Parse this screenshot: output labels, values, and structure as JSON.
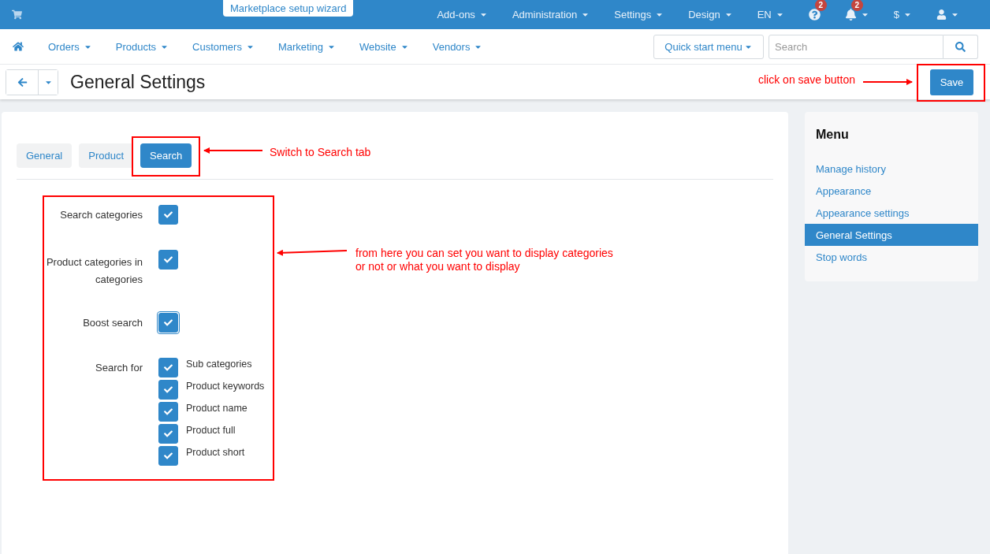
{
  "top_bar": {
    "wizard_button": "Marketplace setup wizard",
    "items": [
      {
        "kind": "menu",
        "label": "Add-ons"
      },
      {
        "kind": "menu",
        "label": "Administration"
      },
      {
        "kind": "menu",
        "label": "Settings"
      },
      {
        "kind": "menu",
        "label": "Design"
      },
      {
        "kind": "menu",
        "label": "EN"
      },
      {
        "kind": "help",
        "badge": "2"
      },
      {
        "kind": "bell",
        "badge": "2"
      },
      {
        "kind": "menu",
        "label": "$"
      },
      {
        "kind": "user"
      }
    ]
  },
  "nav": {
    "items": [
      "Orders",
      "Products",
      "Customers",
      "Marketing",
      "Website",
      "Vendors"
    ],
    "quick_start": "Quick start menu",
    "search": {
      "placeholder": "Search"
    }
  },
  "header": {
    "title": "General Settings",
    "save_button": "Save"
  },
  "tabs": [
    {
      "label": "General",
      "selected": false
    },
    {
      "label": "Product",
      "selected": false
    },
    {
      "label": "Search",
      "selected": true
    }
  ],
  "fields": [
    {
      "kind": "checkbox",
      "label": "Search categories",
      "checked": true,
      "focused": false
    },
    {
      "kind": "checkbox",
      "label": "Product categories in categories",
      "checked": true,
      "focused": false
    },
    {
      "kind": "checkbox",
      "label": "Boost search",
      "checked": true,
      "focused": true
    },
    {
      "kind": "group",
      "label": "Search for",
      "options": [
        {
          "label": "Sub categories",
          "checked": true
        },
        {
          "label": "Product keywords",
          "checked": true
        },
        {
          "label": "Product name",
          "checked": true
        },
        {
          "label": "Product full",
          "checked": true
        },
        {
          "label": "Product short",
          "checked": true
        }
      ]
    }
  ],
  "sidebar": {
    "title": "Menu",
    "items": [
      {
        "label": "Manage history",
        "selected": false
      },
      {
        "label": "Appearance",
        "selected": false
      },
      {
        "label": "Appearance settings",
        "selected": false
      },
      {
        "label": "General Settings",
        "selected": true
      },
      {
        "label": "Stop words",
        "selected": false
      }
    ]
  },
  "annotations": [
    "click on save button",
    "Switch to Search tab",
    "from here you can set you want to display categories or not or what you want to display"
  ]
}
